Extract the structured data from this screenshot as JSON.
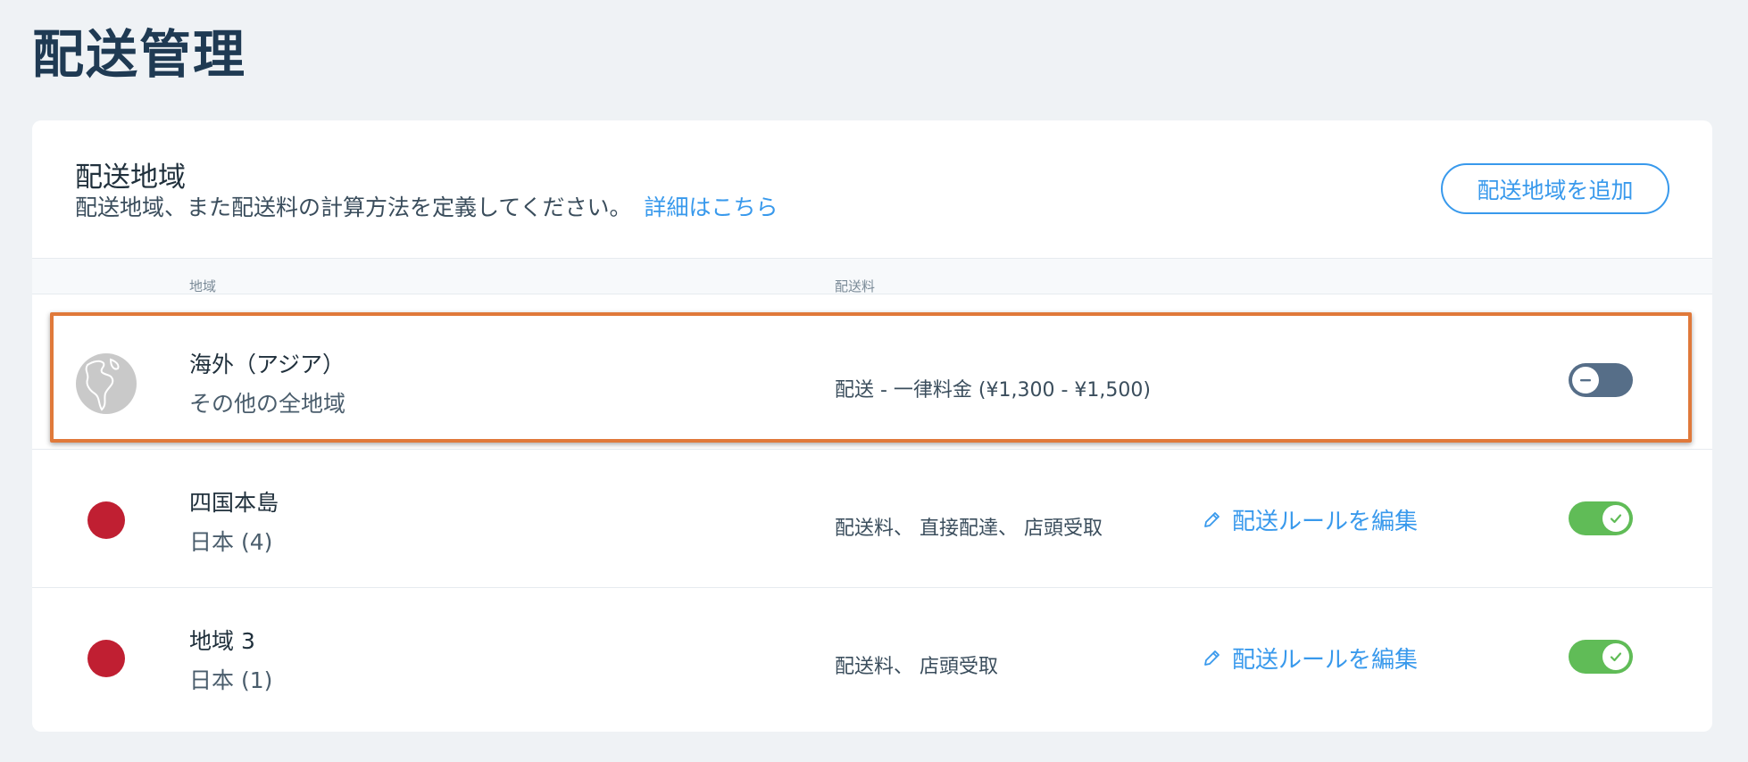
{
  "page": {
    "title": "配送管理"
  },
  "section": {
    "title": "配送地域",
    "description": "配送地域、また配送料の計算方法を定義してください。",
    "learn_more": "詳細はこちら",
    "add_button": "配送地域を追加"
  },
  "columns": {
    "region": "地域",
    "fee": "配送料"
  },
  "rows": [
    {
      "name": "海外（アジア）",
      "sub": "その他の全地域",
      "fee": "配送 - 一律料金  (¥1,300 - ¥1,500)",
      "edit": "",
      "icon": "globe-icon",
      "enabled": false
    },
    {
      "name": "四国本島",
      "sub": "日本 (4)",
      "fee": "配送料、 直接配達、 店頭受取",
      "edit": "配送ルールを編集",
      "icon": "japan-flag-icon",
      "enabled": true
    },
    {
      "name": "地域 3",
      "sub": "日本 (1)",
      "fee": "配送料、 店頭受取",
      "edit": "配送ルールを編集",
      "icon": "japan-flag-icon",
      "enabled": true
    }
  ],
  "colors": {
    "accent": "#3899ec",
    "toggle_on": "#60bc57",
    "toggle_off": "#566e88",
    "highlight": "#e0793a",
    "flag": "#c01f32"
  }
}
